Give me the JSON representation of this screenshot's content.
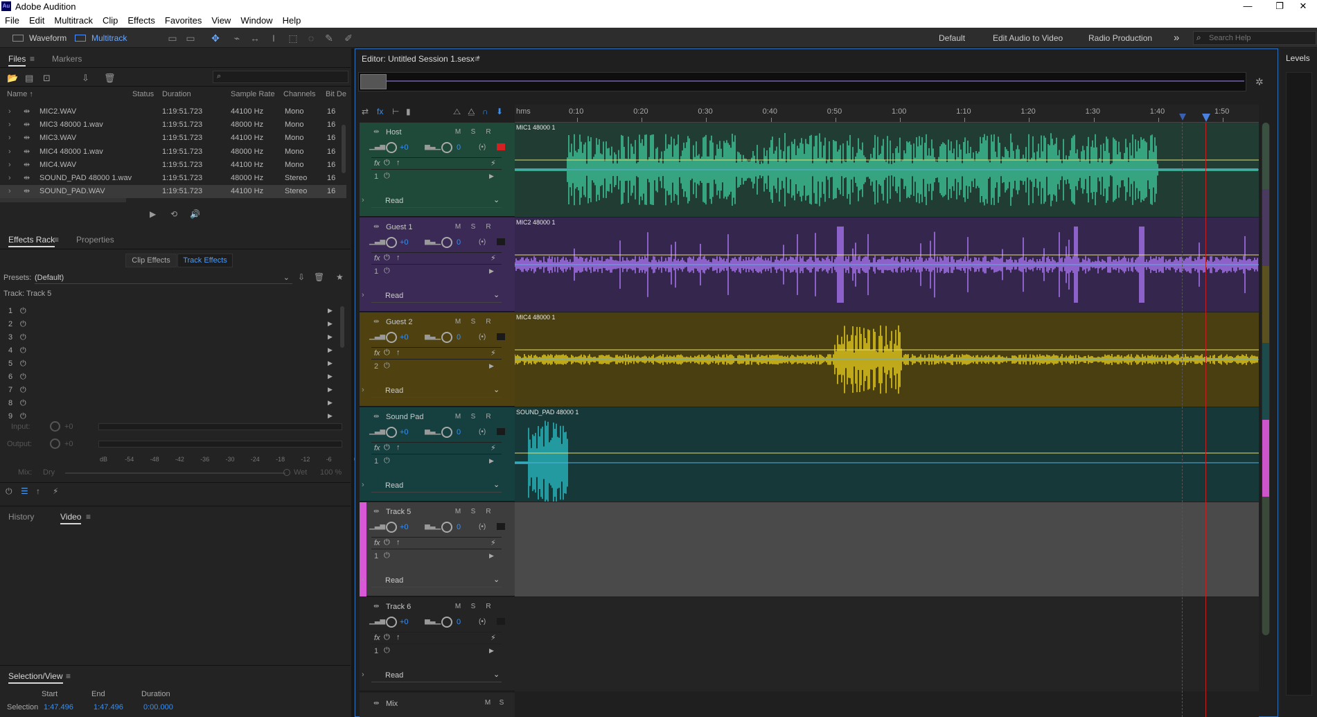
{
  "app": {
    "title": "Adobe Audition",
    "logo_text": "Au"
  },
  "window_controls": {
    "minimize": "—",
    "restore": "❐",
    "close": "✕"
  },
  "menu": [
    "File",
    "Edit",
    "Multitrack",
    "Clip",
    "Effects",
    "Favorites",
    "View",
    "Window",
    "Help"
  ],
  "toolbar": {
    "waveform": "Waveform",
    "multitrack": "Multitrack",
    "workspaces": [
      "Default",
      "Edit Audio to Video",
      "Radio Production"
    ],
    "more": "»",
    "search_placeholder": "Search Help"
  },
  "files_panel": {
    "tabs": [
      "Files",
      "Markers"
    ],
    "columns": [
      "Name ↑",
      "Status",
      "Duration",
      "Sample Rate",
      "Channels",
      "Bit De"
    ],
    "rows": [
      {
        "name": "MIC2.WAV",
        "duration": "1:19:51.723",
        "rate": "44100 Hz",
        "channels": "Mono",
        "bits": "16"
      },
      {
        "name": "MIC3 48000 1.wav",
        "duration": "1:19:51.723",
        "rate": "48000 Hz",
        "channels": "Mono",
        "bits": "16"
      },
      {
        "name": "MIC3.WAV",
        "duration": "1:19:51.723",
        "rate": "44100 Hz",
        "channels": "Mono",
        "bits": "16"
      },
      {
        "name": "MIC4 48000 1.wav",
        "duration": "1:19:51.723",
        "rate": "48000 Hz",
        "channels": "Mono",
        "bits": "16"
      },
      {
        "name": "MIC4.WAV",
        "duration": "1:19:51.723",
        "rate": "44100 Hz",
        "channels": "Mono",
        "bits": "16"
      },
      {
        "name": "SOUND_PAD 48000 1.wav",
        "duration": "1:19:51.723",
        "rate": "48000 Hz",
        "channels": "Stereo",
        "bits": "16"
      },
      {
        "name": "SOUND_PAD.WAV",
        "duration": "1:19:51.723",
        "rate": "44100 Hz",
        "channels": "Stereo",
        "bits": "16"
      }
    ]
  },
  "effects_rack": {
    "tabs": [
      "Effects Rack",
      "Properties"
    ],
    "subtabs": [
      "Clip Effects",
      "Track Effects"
    ],
    "presets_label": "Presets:",
    "presets_value": "(Default)",
    "track_label": "Track: Track 5",
    "slots": [
      "1",
      "2",
      "3",
      "4",
      "5",
      "6",
      "7",
      "8",
      "9"
    ],
    "input_label": "Input:",
    "input_value": "+0",
    "output_label": "Output:",
    "output_value": "+0",
    "scale": [
      "dB",
      "-54",
      "-48",
      "-42",
      "-36",
      "-30",
      "-24",
      "-18",
      "-12",
      "-6",
      "0"
    ],
    "mix_label": "Mix:",
    "mix_dry": "Dry",
    "mix_wet": "Wet",
    "mix_pct": "100 %"
  },
  "history_panel": {
    "tabs": [
      "History",
      "Video"
    ]
  },
  "selection_view": {
    "title": "Selection/View",
    "headers": [
      "Start",
      "End",
      "Duration"
    ],
    "row_label": "Selection",
    "start": "1:47.496",
    "end": "1:47.496",
    "duration": "0:00.000"
  },
  "editor": {
    "title": "Editor: Untitled Session 1.sesx *",
    "ruler_unit": "hms",
    "ruler": [
      "0:10",
      "0:20",
      "0:30",
      "0:40",
      "0:50",
      "1:00",
      "1:10",
      "1:20",
      "1:30",
      "1:40",
      "1:50"
    ],
    "mix_label": "Mix",
    "mix_buttons": [
      "M",
      "S"
    ]
  },
  "tracks": [
    {
      "name": "Host",
      "clip": "MIC1 48000 1",
      "volume": "+0",
      "pan": "0",
      "slot": "1",
      "read": "Read",
      "bg": "#1f4a3a",
      "wave": "#3fd1a0",
      "lanebg": "#213d33",
      "label_color": ""
    },
    {
      "name": "Guest 1",
      "clip": "MIC2 48000 1",
      "volume": "+0",
      "pan": "0",
      "slot": "1",
      "read": "Read",
      "bg": "#3b2a55",
      "wave": "#b37bff",
      "lanebg": "#34264d",
      "label_color": ""
    },
    {
      "name": "Guest 2",
      "clip": "MIC4 48000 1",
      "volume": "+0",
      "pan": "0",
      "slot": "2",
      "read": "Read",
      "bg": "#4f4210",
      "wave": "#f2d71f",
      "lanebg": "#4a3f11",
      "label_color": ""
    },
    {
      "name": "Sound Pad",
      "clip": "SOUND_PAD 48000 1",
      "volume": "+0",
      "pan": "0",
      "slot": "1",
      "read": "Read",
      "bg": "#164040",
      "wave": "#27c4cc",
      "lanebg": "#173838",
      "label_color": ""
    },
    {
      "name": "Track 5",
      "clip": "",
      "volume": "+0",
      "pan": "0",
      "slot": "1",
      "read": "Read",
      "bg": "#3d3d3d",
      "wave": "",
      "lanebg": "#4a4a4a",
      "label_color": "#d858d8"
    },
    {
      "name": "Track 6",
      "clip": "",
      "volume": "+0",
      "pan": "0",
      "slot": "1",
      "read": "Read",
      "bg": "#242424",
      "wave": "",
      "lanebg": "#242424",
      "label_color": ""
    }
  ],
  "levels": {
    "title": "Levels"
  },
  "track_buttons": {
    "mute": "M",
    "solo": "S",
    "record": "R",
    "fx": "fx"
  }
}
